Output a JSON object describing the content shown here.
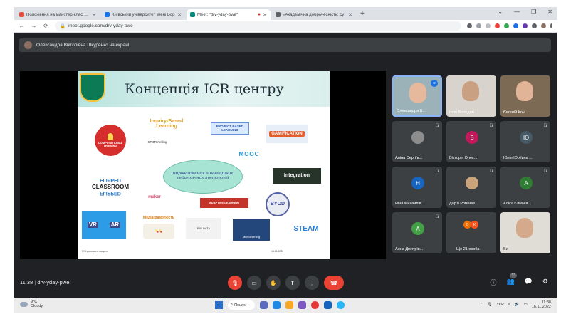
{
  "browser": {
    "tabs": [
      {
        "title": "Положення на майстер-клас «Ві",
        "favicon_color": "#e74c3c",
        "active": false,
        "recording": false
      },
      {
        "title": "Київський університет імені Бор",
        "favicon_color": "#1a73e8",
        "active": false,
        "recording": false
      },
      {
        "title": "Meet: \"drv-yday-pwe\"",
        "favicon_color": "#00897b",
        "active": true,
        "recording": true
      },
      {
        "title": "«Академічна доброчесність: су",
        "favicon_color": "#5f6368",
        "active": false,
        "recording": false
      }
    ],
    "new_tab_label": "+",
    "window_controls": [
      "⌄",
      "—",
      "❐",
      "✕"
    ],
    "address": "meet.google.com/drv-yday-pwe",
    "nav_icons": [
      "←",
      "→",
      "⟳"
    ]
  },
  "meet": {
    "presenting_banner": "Олександра Вікторівна Шкуренко на екрані",
    "meeting_time": "11:38",
    "meeting_code": "drv-yday-pwe",
    "people_count": "33"
  },
  "slide": {
    "title": "Концепція ICR центру",
    "computational_thinking": "COMPUTATIONAL THINKING",
    "inquiry_based": "Inquiry-Based Learning",
    "project_based": "PROJECT BASED LEARNING",
    "gamification": "GAMIFICATION",
    "storytelling": "STORYtelling",
    "mooc": "MOOC",
    "center_text": "Впровадження інноваційних педагогічних технологій",
    "flipped_top": "FLIPPED",
    "flipped_middle": "CLASSROOM",
    "flipped_bottom": "FLIPPED",
    "integration": "Integration",
    "maker": "maker",
    "adaptive": "ADAPTIVE LEARNING",
    "byod": "BYOD",
    "vr": "VR",
    "ar": "AR",
    "media": "Медіаграмотність",
    "big_data": "BIG DATA",
    "microlearning": "Microlearning",
    "steam": "STEAM",
    "footer_left": "ГУК допомоги, південн",
    "footer_right": "16.11.2022"
  },
  "participants": [
    {
      "name": "Олександра В...",
      "type": "video",
      "bg": "#9bb3b8",
      "face": "#e6b89c",
      "speaking": true,
      "muted": false
    },
    {
      "name": "Ілля Володим...",
      "type": "video",
      "bg": "#d8d3cc",
      "face": "#caa082",
      "speaking": false,
      "muted": false
    },
    {
      "name": "Євгеній Коч...",
      "type": "video",
      "bg": "#7d6a55",
      "face": "#e2b497",
      "speaking": false,
      "muted": false
    },
    {
      "name": "Аліна Сергіїв...",
      "type": "photo-avatar",
      "avatar_color": "#8d8d8d",
      "letter": "",
      "muted": true
    },
    {
      "name": "Вікторія Олек...",
      "type": "avatar",
      "avatar_color": "#c2185b",
      "letter": "В",
      "muted": true
    },
    {
      "name": "Юлія Юріївна ...",
      "type": "avatar",
      "avatar_color": "#455a64",
      "letter": "Ю",
      "muted": true
    },
    {
      "name": "Ніна Михайлів...",
      "type": "avatar",
      "avatar_color": "#1565c0",
      "letter": "Н",
      "muted": true
    },
    {
      "name": "Дар'я Романів...",
      "type": "photo-avatar",
      "avatar_color": "#c9a37a",
      "letter": "",
      "muted": true
    },
    {
      "name": "Аліса Євгенія...",
      "type": "avatar",
      "avatar_color": "#2e7d32",
      "letter": "А",
      "muted": true
    },
    {
      "name": "Анна Дмитрів...",
      "type": "avatar",
      "avatar_color": "#43a047",
      "letter": "А",
      "muted": true
    },
    {
      "name": "Ще 21 особа",
      "type": "more",
      "letters": [
        "О",
        "К"
      ],
      "colors": [
        "#ef6c00",
        "#f4511e"
      ],
      "muted": false
    },
    {
      "name": "Ви",
      "type": "video",
      "bg": "#e0dcd6",
      "face": "#d4a98c",
      "speaking": false,
      "muted": false
    }
  ],
  "controls": {
    "mic": "🎙",
    "camera": "▭",
    "hand": "✋",
    "present": "⬆",
    "more": "⋮",
    "end_call": "☎",
    "info": "ⓘ",
    "people": "👥",
    "chat": "💬",
    "activities": "⚙"
  },
  "taskbar": {
    "temperature": "9°C",
    "weather": "Cloudy",
    "search_label": "Пошук",
    "language": "УКР",
    "time": "11:38",
    "date": "16.11.2022"
  },
  "colors": {
    "meet_bg": "#202124",
    "end_call": "#ea4335",
    "accent": "#1a73e8"
  }
}
